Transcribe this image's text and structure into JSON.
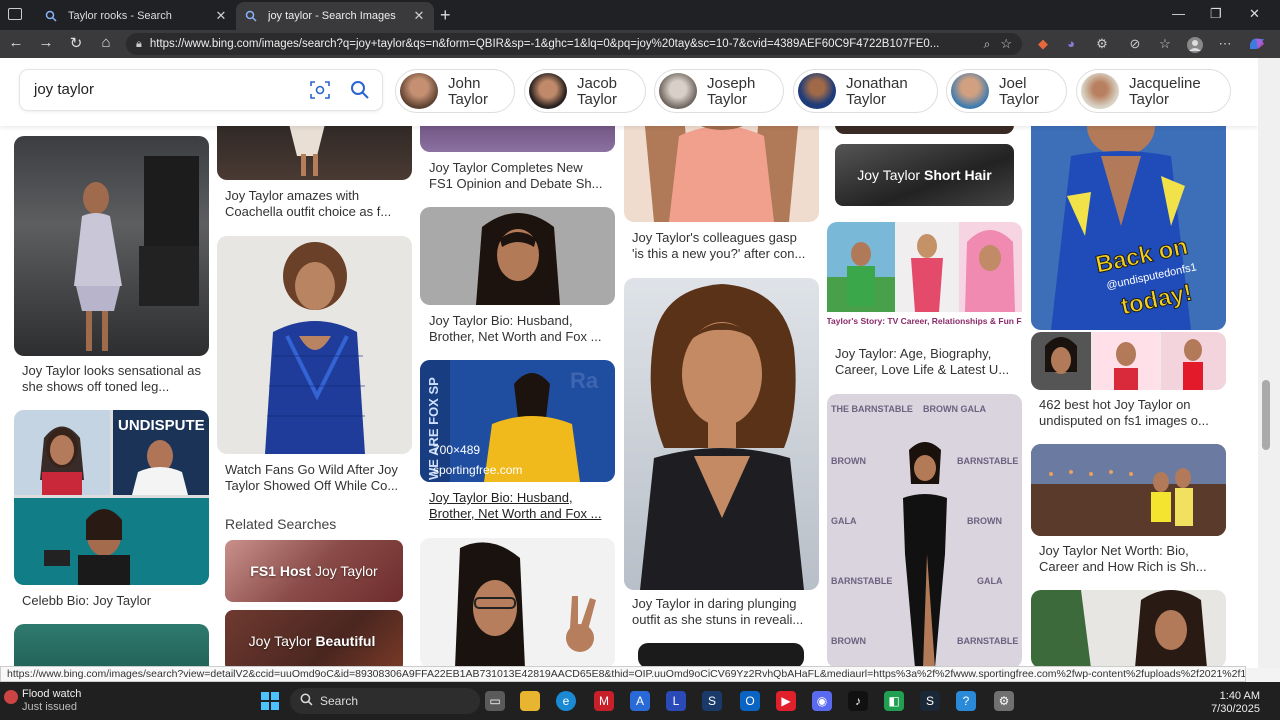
{
  "browser": {
    "tabs": [
      {
        "title": "Taylor rooks - Search",
        "active": false
      },
      {
        "title": "joy taylor - Search Images",
        "active": true
      }
    ],
    "url": "https://www.bing.com/images/search?q=joy+taylor&qs=n&form=QBIR&sp=-1&ghc=1&lq=0&pq=joy%20tay&sc=10-7&cvid=4389AEF60C9F4722B107FE0..."
  },
  "search": {
    "query": "joy taylor"
  },
  "related_people": [
    {
      "name": "John\nTaylor"
    },
    {
      "name": "Jacob\nTaylor"
    },
    {
      "name": "Joseph\nTaylor"
    },
    {
      "name": "Jonathan\nTaylor"
    },
    {
      "name": "Joel\nTaylor"
    },
    {
      "name": "Jacqueline\nTaylor"
    }
  ],
  "results": {
    "col1": [
      "Joy Taylor looks sensational as she shows off toned leg...",
      "Celebb Bio: Joy Taylor"
    ],
    "col2": [
      "Joy Taylor amazes with Coachella outfit choice as f...",
      "Watch Fans Go Wild After Joy Taylor Showed Off While Co..."
    ],
    "col3": [
      "Joy Taylor Completes New FS1 Opinion and Debate Sh...",
      "Joy Taylor Bio: Husband, Brother, Net Worth and Fox ...",
      "Joy Taylor Bio: Husband, Brother, Net Worth and Fox ..."
    ],
    "col4": [
      "Joy Taylor's colleagues gasp 'is this a new you?' after con...",
      "Joy Taylor in daring plunging outfit as she stuns in reveali..."
    ],
    "col5": [
      "Joy Taylor: Age, Biography, Career, Love Life & Latest U..."
    ],
    "col6": [
      "462 best hot Joy Taylor on undisputed on fs1 images o...",
      "Joy Taylor Net Worth: Bio, Career and How Rich is Sh..."
    ]
  },
  "image_overlays": {
    "short_hair_bold": "Short Hair",
    "short_hair_prefix": "Joy Taylor",
    "hover_size": "700×489",
    "hover_domain": "sportingfree.com",
    "back_on": "Back on",
    "today": "today!",
    "tag": "@undisputedonfs1",
    "story_caption": "Joy Taylor's Story: TV Career, Relationships & Fun Facts",
    "undisputed": "UNDISPUTE",
    "gala": "THE BARNSTABLE BROWN GALA"
  },
  "related_searches": {
    "heading": "Related Searches",
    "items": [
      {
        "bold": "FS1 Host",
        "rest": "Joy Taylor"
      },
      {
        "bold": "",
        "rest": "Joy Taylor",
        "bold_after": "Beautiful"
      }
    ]
  },
  "statusbar": "https://www.bing.com/images/search?view=detailV2&ccid=uuOmd9oC&id=89308306A9FFA22EB1AB731013E42819AACD65E8&thid=OIP.uuOmd9oCiCV69Yz2RvhQbAHaFL&mediaurl=https%3a%2f%2fwww.sportingfree.com%2fwp-content%2fuploads%2f2021%2f11%2fJoy-Taylo...",
  "taskbar": {
    "weather_title": "Flood watch",
    "weather_sub": "Just issued",
    "search_label": "Search",
    "time": "1:40 AM",
    "date": "7/30/2025"
  }
}
